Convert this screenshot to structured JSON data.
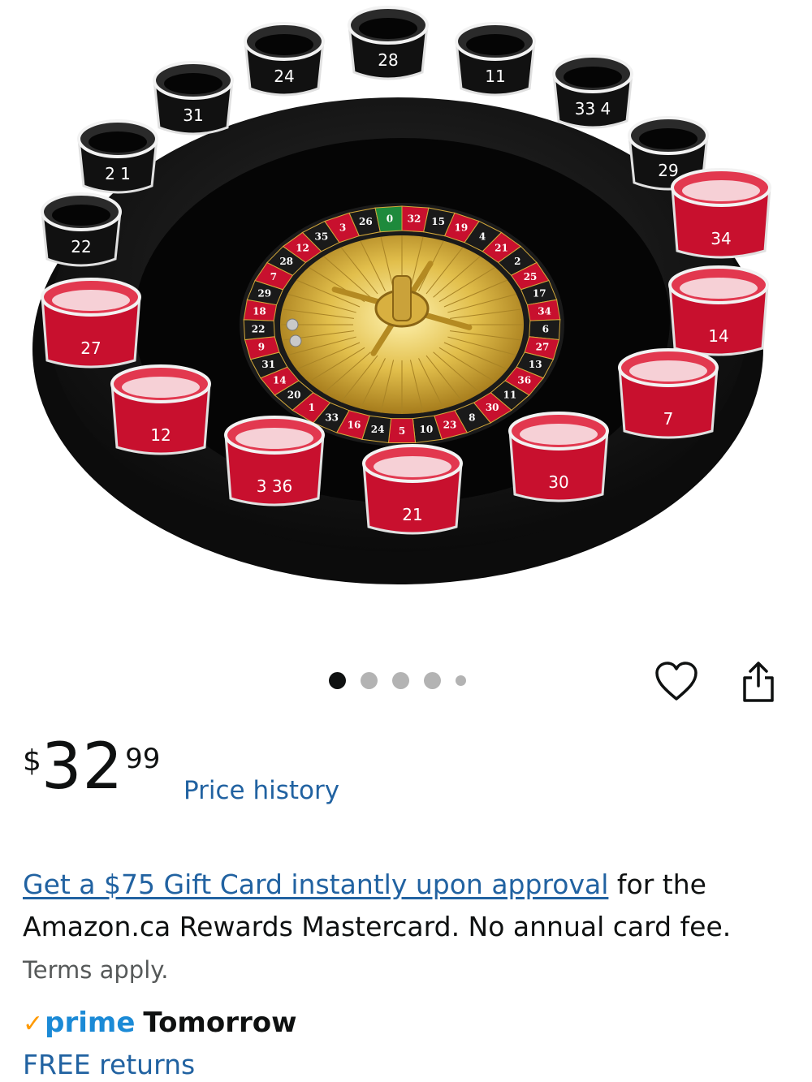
{
  "product_image": {
    "alt": "Roulette drinking game with shot glasses",
    "glass_numbers_black": [
      "22",
      "2 1",
      "31",
      "24",
      "28",
      "11",
      "33 4",
      "29"
    ],
    "glass_numbers_red": [
      "27",
      "12",
      "3 36",
      "21",
      "30",
      "7",
      "14",
      "34"
    ],
    "wheel_numbers": [
      "32",
      "15",
      "19",
      "4",
      "21",
      "2",
      "25",
      "17",
      "34",
      "6",
      "27",
      "13",
      "36",
      "11",
      "30",
      "8",
      "23",
      "10",
      "5",
      "24",
      "16",
      "33",
      "1",
      "20",
      "14",
      "31",
      "9",
      "22",
      "18",
      "29",
      "7",
      "28",
      "12",
      "35",
      "3",
      "26",
      "0"
    ],
    "colors": {
      "black": "#1a1a1a",
      "red": "#c8102e",
      "green": "#1e8a3c",
      "gold": "#d4a93a"
    }
  },
  "carousel": {
    "count": 5,
    "active_index": 0
  },
  "actions": {
    "favorite_icon": "heart-icon",
    "share_icon": "share-icon"
  },
  "price": {
    "symbol": "$",
    "whole": "32",
    "fraction": "99",
    "history_link": "Price history"
  },
  "promo": {
    "link_text": "Get a $75 Gift Card instantly upon approval",
    "body_text": " for the Amazon.ca Rewards Mastercard. No annual card fee.",
    "terms_text": "Terms apply."
  },
  "delivery": {
    "prime_check": "✓",
    "prime_label": "prime",
    "day": "Tomorrow"
  },
  "returns": {
    "label": "FREE returns"
  },
  "colors": {
    "link": "#2162a1",
    "prime_blue": "#1b8ad6",
    "prime_orange": "#ff9900",
    "text": "#0f1111",
    "muted": "#565959"
  }
}
